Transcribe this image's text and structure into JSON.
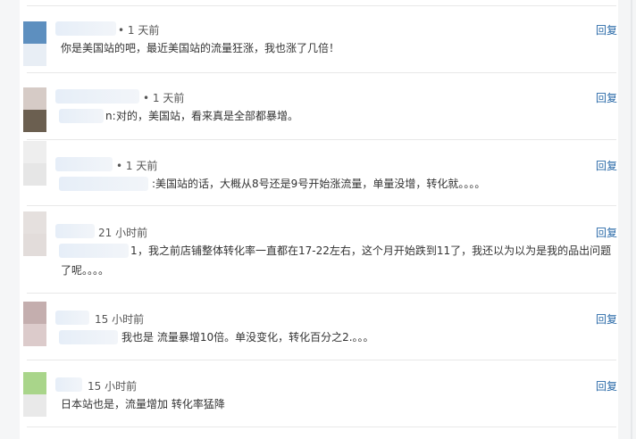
{
  "comments": [
    {
      "time": "• 1 天前",
      "text": "你是美国站的吧，最近美国站的流量狂涨，我也涨了几倍！",
      "reply": "回复",
      "avatar_top": "#5d8fbf",
      "avatar_bottom": "#e8eef5"
    },
    {
      "time": "• 1 天前",
      "prefix": "n:",
      "text": "对的，美国站，看来真是全部都暴增。",
      "reply": "回复",
      "avatar_top": "#d6cbc6",
      "avatar_bottom": "#6b5f50"
    },
    {
      "time": "• 1 天前",
      "text": ":美国站的话，大概从8号还是9号开始涨流量，单量没增，转化就。。。。",
      "reply": "回复",
      "avatar_top": "#eeeeee",
      "avatar_bottom": "#e6e6e6"
    },
    {
      "time": "21 小时前",
      "prefix": "1",
      "text": "，我之前店铺整体转化率一直都在17-22左右，这个月开始跌到11了，我还以为以为是我的品出问题",
      "text2": "了呢。。。。",
      "reply": "回复",
      "avatar_top": "#e5e0de",
      "avatar_bottom": "#e2dcda"
    },
    {
      "time": "15 小时前",
      "text": "我也是 流量暴增10倍。单没变化，转化百分之2.。。。",
      "reply": "回复",
      "avatar_top": "#c4aeae",
      "avatar_bottom": "#dccbcb"
    },
    {
      "time": "15 小时前",
      "text": "日本站也是，流量增加 转化率猛降",
      "reply": "回复",
      "avatar_top": "#a9d58a",
      "avatar_bottom": "#e9e9e9"
    }
  ]
}
